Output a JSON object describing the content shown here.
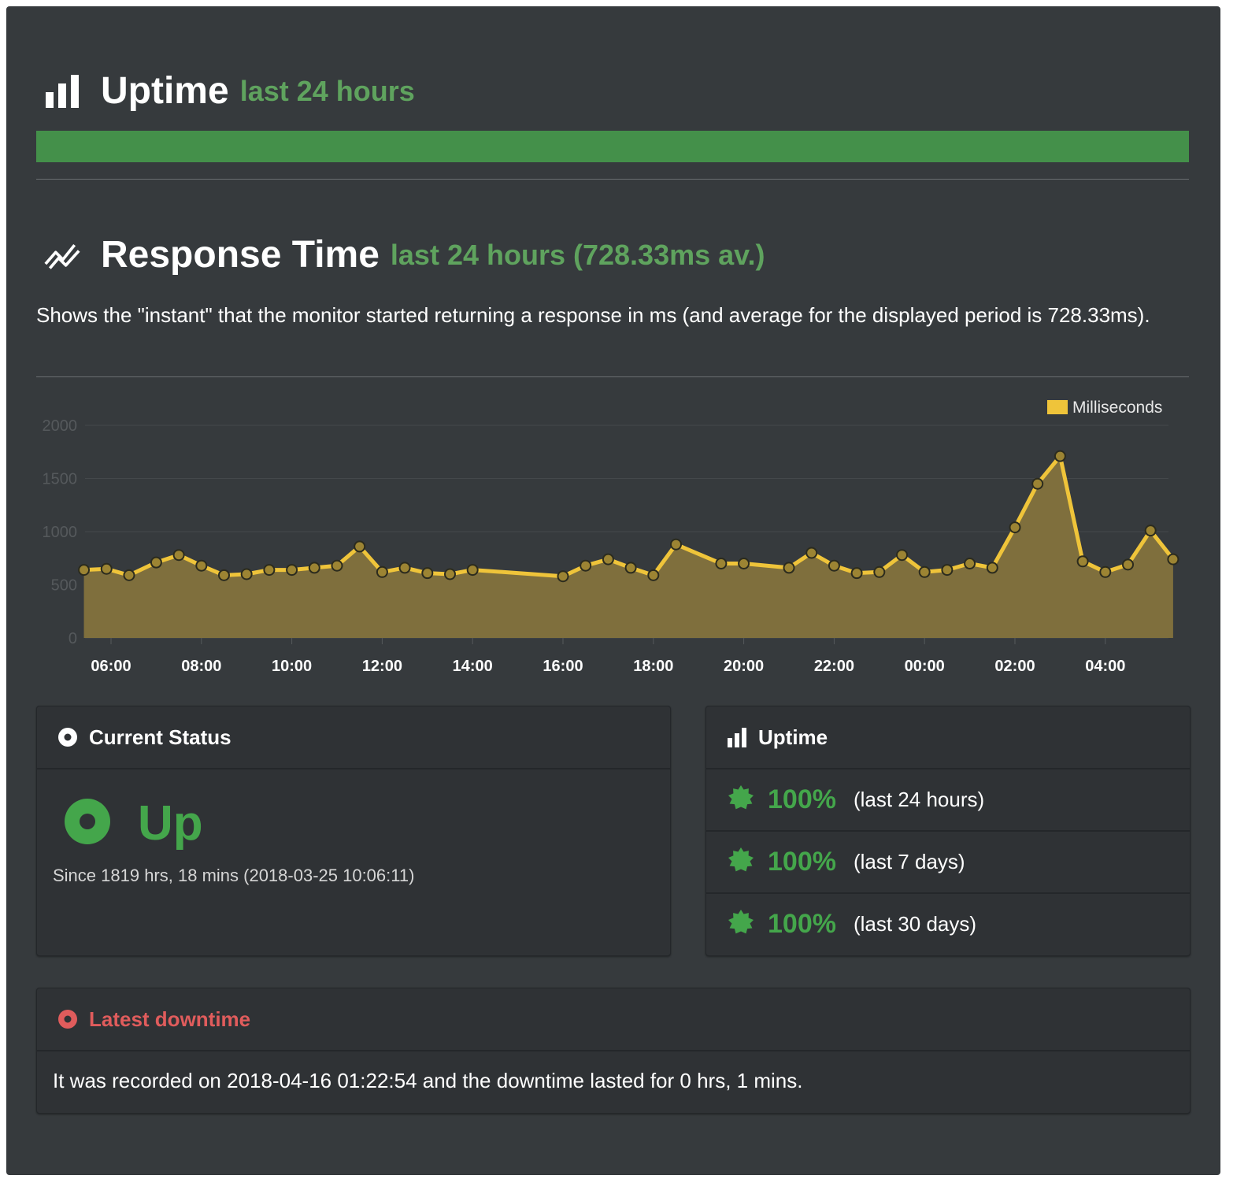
{
  "uptime_section": {
    "title": "Uptime",
    "subtitle": "last 24 hours",
    "bar_fraction": 1.0,
    "bar_color": "#44904a"
  },
  "response_section": {
    "title": "Response Time",
    "subtitle": "last 24 hours (728.33ms av.)",
    "description": "Shows the \"instant\" that the monitor started returning a response in ms (and average for the displayed period is 728.33ms)."
  },
  "colors": {
    "accent_green": "#5fa35e",
    "status_green": "#44a64b",
    "line_yellow": "#efc43a",
    "area_fill": "#7f6f3d",
    "danger_red": "#e05c5c"
  },
  "chart_data": {
    "type": "area",
    "legend": "Milliseconds",
    "legend_position": "top-right",
    "grid": true,
    "ylim": [
      0,
      2000
    ],
    "y_ticks": [
      "0",
      "500",
      "1000",
      "1500",
      "2000"
    ],
    "x_ticks": [
      "06:00",
      "08:00",
      "10:00",
      "12:00",
      "14:00",
      "16:00",
      "18:00",
      "20:00",
      "22:00",
      "00:00",
      "02:00",
      "04:00"
    ],
    "series": [
      {
        "name": "Milliseconds",
        "points": [
          [
            -0.6,
            640
          ],
          [
            -0.1,
            650
          ],
          [
            0.4,
            590
          ],
          [
            1.0,
            710
          ],
          [
            1.5,
            780
          ],
          [
            2.0,
            680
          ],
          [
            2.5,
            590
          ],
          [
            3.0,
            600
          ],
          [
            3.5,
            640
          ],
          [
            4.0,
            640
          ],
          [
            4.5,
            660
          ],
          [
            5.0,
            680
          ],
          [
            5.5,
            860
          ],
          [
            6.0,
            620
          ],
          [
            6.5,
            660
          ],
          [
            7.0,
            610
          ],
          [
            7.5,
            600
          ],
          [
            8.0,
            640
          ],
          [
            10.0,
            580
          ],
          [
            10.5,
            680
          ],
          [
            11.0,
            740
          ],
          [
            11.5,
            660
          ],
          [
            12.0,
            590
          ],
          [
            12.5,
            880
          ],
          [
            13.5,
            700
          ],
          [
            14.0,
            700
          ],
          [
            15.0,
            660
          ],
          [
            15.5,
            800
          ],
          [
            16.0,
            680
          ],
          [
            16.5,
            610
          ],
          [
            17.0,
            620
          ],
          [
            17.5,
            780
          ],
          [
            18.0,
            620
          ],
          [
            18.5,
            640
          ],
          [
            19.0,
            700
          ],
          [
            19.5,
            660
          ],
          [
            20.0,
            1040
          ],
          [
            20.5,
            1450
          ],
          [
            21.0,
            1710
          ],
          [
            21.5,
            720
          ],
          [
            22.0,
            620
          ],
          [
            22.5,
            690
          ],
          [
            23.0,
            1010
          ],
          [
            23.5,
            740
          ]
        ]
      }
    ]
  },
  "current_status": {
    "header": "Current Status",
    "state": "Up",
    "since": "Since 1819 hrs, 18 mins (2018-03-25 10:06:11)"
  },
  "uptime_card": {
    "header": "Uptime",
    "rows": [
      {
        "percent": "100%",
        "period": "(last 24 hours)"
      },
      {
        "percent": "100%",
        "period": "(last 7 days)"
      },
      {
        "percent": "100%",
        "period": "(last 30 days)"
      }
    ]
  },
  "latest_downtime": {
    "header": "Latest downtime",
    "text": "It was recorded on 2018-04-16 01:22:54 and the downtime lasted for 0 hrs, 1 mins."
  }
}
